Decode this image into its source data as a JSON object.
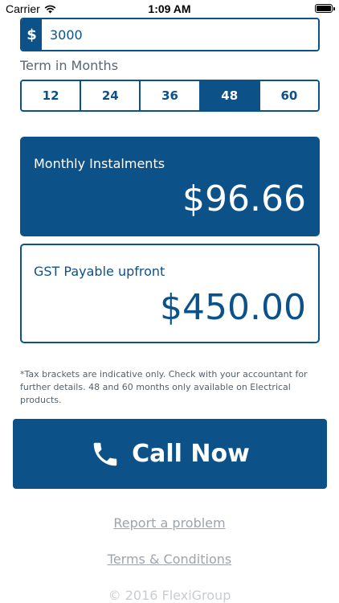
{
  "status_bar": {
    "carrier": "Carrier",
    "time": "1:09 AM",
    "wifi_icon": "wifi-icon",
    "battery_icon": "battery-icon"
  },
  "loan": {
    "currency_symbol": "$",
    "amount_value": "3000"
  },
  "term": {
    "label": "Term in Months",
    "options": [
      "12",
      "24",
      "36",
      "48",
      "60"
    ],
    "selected": "48"
  },
  "monthly": {
    "label": "Monthly Instalments",
    "value": "$96.66"
  },
  "gst": {
    "label": "GST Payable upfront",
    "value": "$450.00"
  },
  "disclaimer": "*Tax brackets are indicative only. Check with your accountant for further details. 48 and 60 months only available on Electrical products.",
  "call": {
    "label": "Call Now",
    "icon": "phone-icon"
  },
  "links": {
    "report": "Report a problem",
    "terms": "Terms & Conditions"
  },
  "copyright": "© 2016 FlexiGroup",
  "colors": {
    "brand": "#0d5189",
    "muted_text": "#5a6672",
    "link_gray": "#9ea4aa"
  }
}
